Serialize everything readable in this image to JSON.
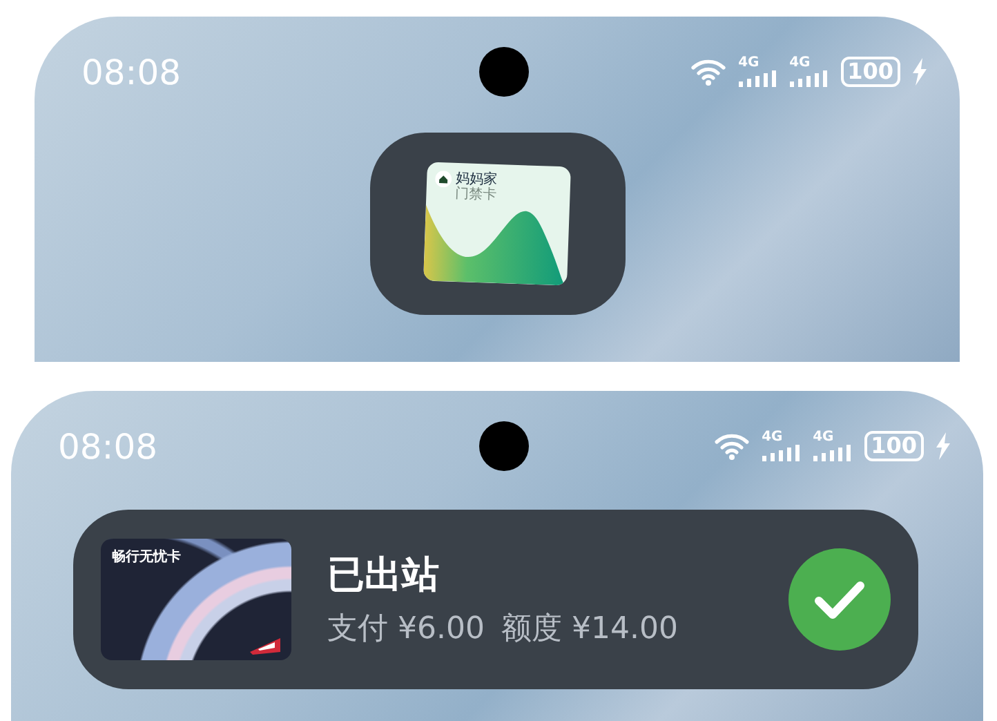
{
  "screens": [
    {
      "kind": "compact",
      "status_bar": {
        "time": "08:08",
        "sims": [
          "4G",
          "4G"
        ],
        "battery": "100",
        "charging": true
      },
      "island": {
        "card_title": "妈妈家",
        "card_subtitle": "门禁卡"
      }
    },
    {
      "kind": "expanded",
      "status_bar": {
        "time": "08:08",
        "sims": [
          "4G",
          "4G"
        ],
        "battery": "100",
        "charging": true
      },
      "island": {
        "card_title": "畅行无忧卡",
        "status": "已出站",
        "details": [
          "支付 ¥6.00",
          "额度 ¥14.00"
        ],
        "done": true
      }
    }
  ]
}
